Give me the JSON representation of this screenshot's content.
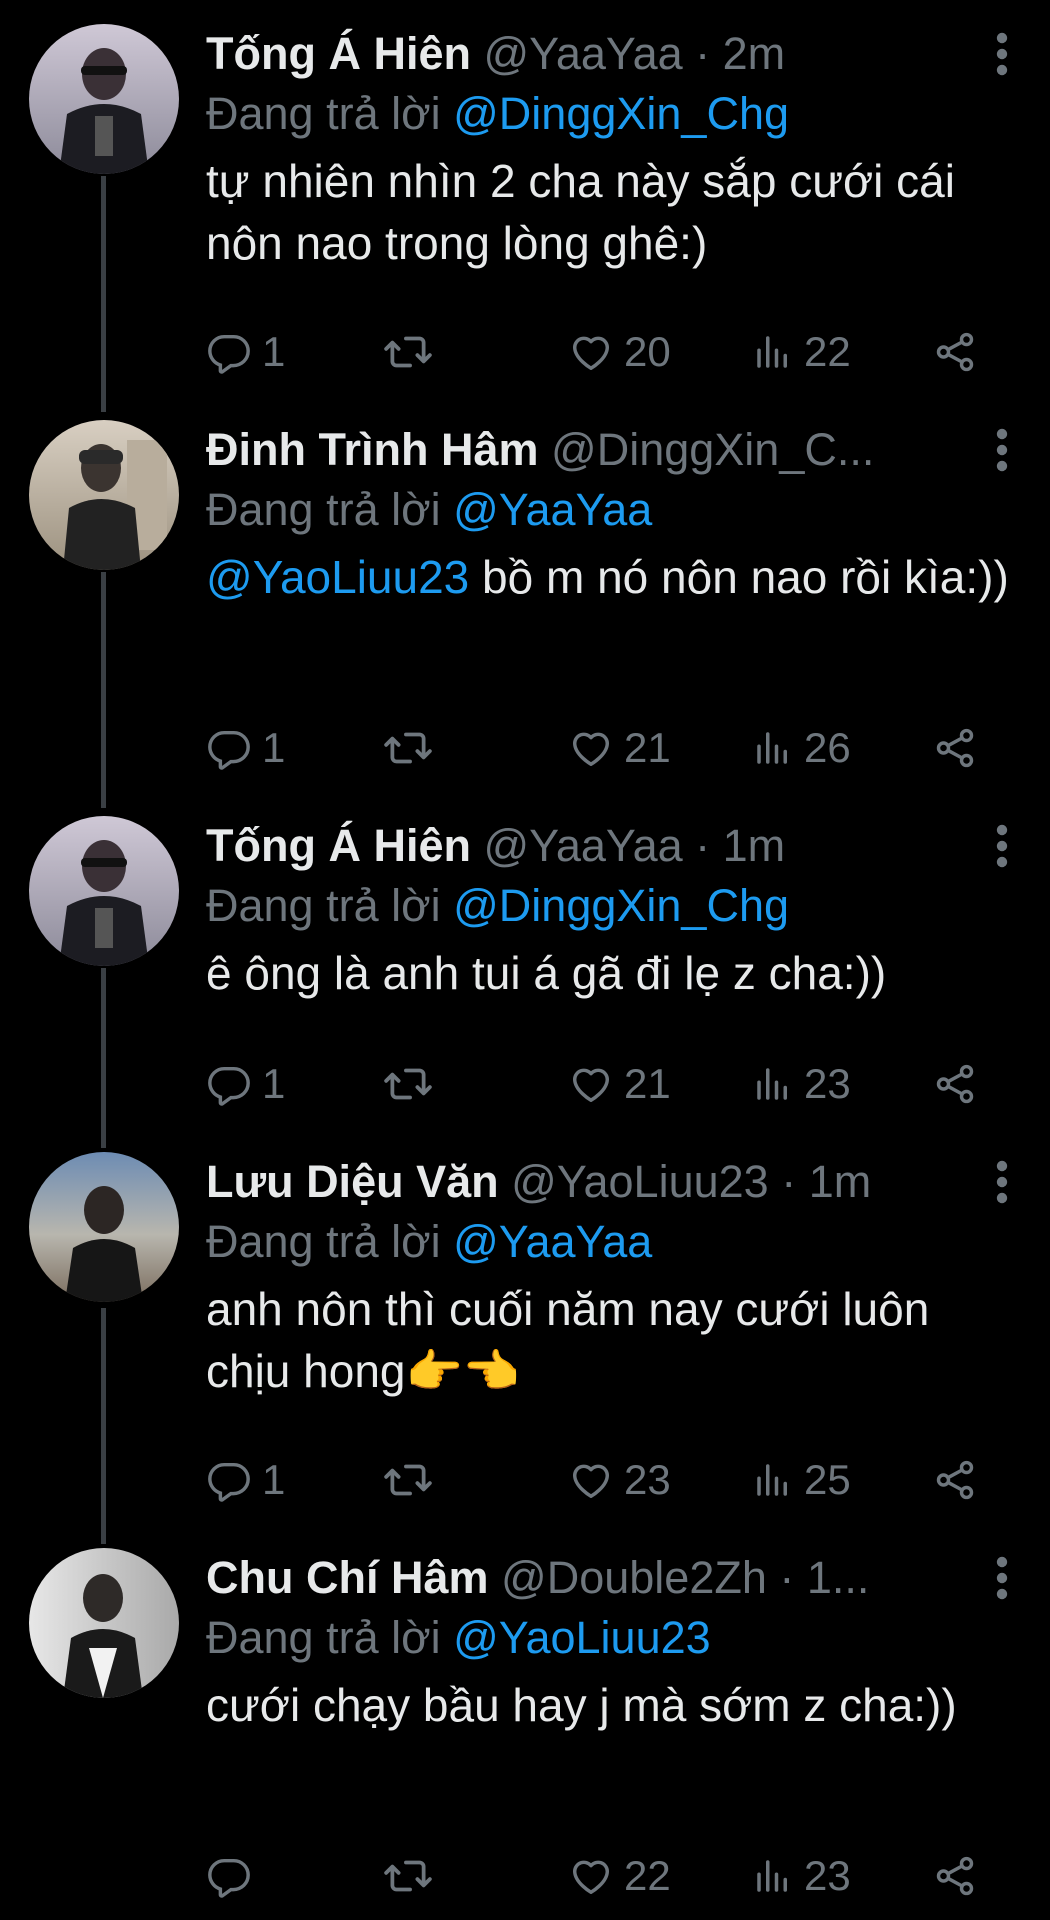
{
  "labels": {
    "replying_prefix": "Đang trả lời"
  },
  "colors": {
    "background": "#000000",
    "text": "#e7e9ea",
    "secondary": "#6e767d",
    "link": "#1d9bf0"
  },
  "tweets": [
    {
      "name": "Tống Á Hiên",
      "handle": "@YaaYaa",
      "time": "· 2m",
      "reply_to": "@DinggXin_Chg",
      "text_mention": "",
      "text": "tự nhiên nhìn 2 cha này sắp cưới cái nôn nao trong lòng ghê:)",
      "replies": "1",
      "retweets": "",
      "likes": "20",
      "views": "22"
    },
    {
      "name": "Đinh Trình Hâm",
      "handle": "@DinggXin_C...",
      "time": "",
      "reply_to": "@YaaYaa",
      "text_mention": "@YaoLiuu23",
      "text": " bồ m nó nôn nao rồi kìa:))",
      "replies": "1",
      "retweets": "",
      "likes": "21",
      "views": "26"
    },
    {
      "name": "Tống Á Hiên",
      "handle": "@YaaYaa",
      "time": "· 1m",
      "reply_to": "@DinggXin_Chg",
      "text_mention": "",
      "text": "ê ông là anh tui á gã đi lẹ z cha:))",
      "replies": "1",
      "retweets": "",
      "likes": "21",
      "views": "23"
    },
    {
      "name": "Lưu Diệu Văn",
      "handle": "@YaoLiuu23",
      "time": "· 1m",
      "reply_to": "@YaaYaa",
      "text_mention": "",
      "text": "anh nôn thì cuối năm nay cưới luôn chịu hong👉👈",
      "replies": "1",
      "retweets": "",
      "likes": "23",
      "views": "25"
    },
    {
      "name": "Chu Chí Hâm",
      "handle": "@Double2Zh",
      "time": "· 1...",
      "reply_to": "@YaoLiuu23",
      "text_mention": "",
      "text": "cưới chạy bầu hay j mà sớm z cha:))",
      "replies": "",
      "retweets": "",
      "likes": "22",
      "views": "23"
    }
  ]
}
